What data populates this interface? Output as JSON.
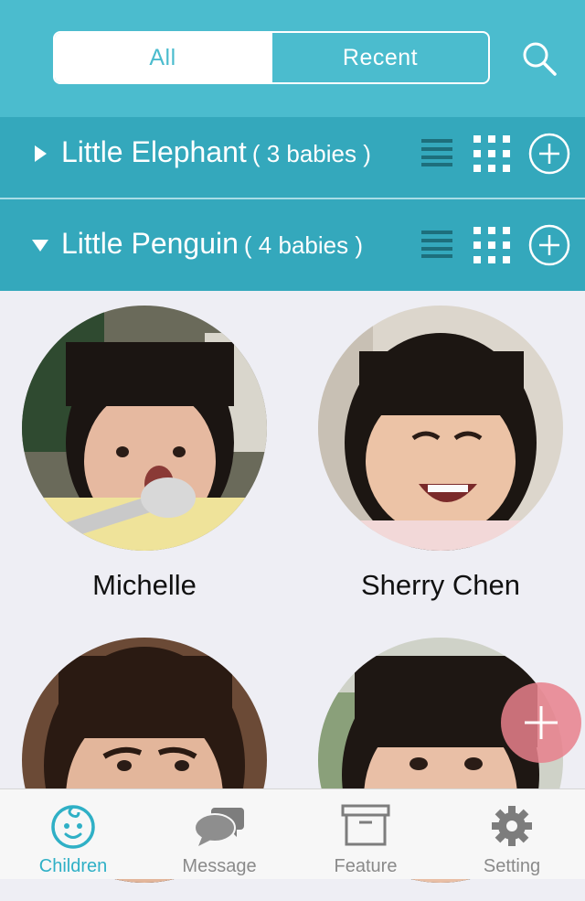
{
  "header": {
    "segments": [
      {
        "label": "All",
        "active": true
      },
      {
        "label": "Recent",
        "active": false
      }
    ],
    "search_icon": "search-icon"
  },
  "groups": [
    {
      "name": "Little Elephant",
      "count": "( 3 babies )",
      "expanded": false
    },
    {
      "name": "Little Penguin",
      "count": "( 4 babies )",
      "expanded": true
    }
  ],
  "children": [
    {
      "name": "Michelle"
    },
    {
      "name": "Sherry Chen"
    },
    {
      "name": ""
    },
    {
      "name": ""
    }
  ],
  "tabbar": {
    "tabs": [
      {
        "label": "Children",
        "icon": "baby-face-icon",
        "active": true
      },
      {
        "label": "Message",
        "icon": "chat-bubbles-icon",
        "active": false
      },
      {
        "label": "Feature",
        "icon": "archive-box-icon",
        "active": false
      },
      {
        "label": "Setting",
        "icon": "gear-icon",
        "active": false
      }
    ]
  },
  "colors": {
    "header": "#4bbcce",
    "group_row": "#34a8bc",
    "active_tab": "#2fb0c6",
    "fab": "#e8808c"
  }
}
